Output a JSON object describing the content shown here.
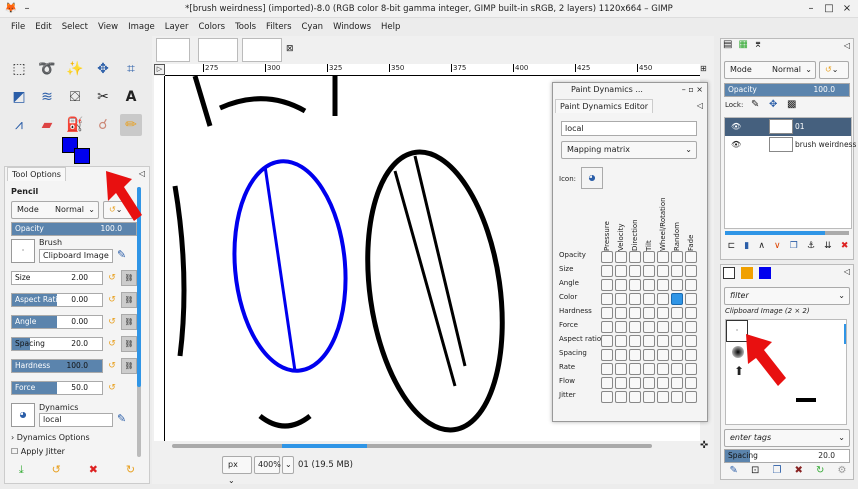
{
  "window": {
    "title": "*[brush weirdness] (imported)-8.0 (RGB color 8-bit gamma integer, GIMP built-in sRGB, 2 layers) 1120x664 – GIMP"
  },
  "menu": [
    "File",
    "Edit",
    "Select",
    "View",
    "Image",
    "Layer",
    "Colors",
    "Tools",
    "Filters",
    "Cyan",
    "Windows",
    "Help"
  ],
  "colors": {
    "foreground": "#0000ee",
    "background": "#0000ee",
    "accent": "#5b84ad",
    "arrow": "#e81010"
  },
  "tool_options": {
    "tab": "Tool Options",
    "tool": "Pencil",
    "mode_label": "Mode",
    "mode_value": "Normal",
    "opacity_label": "Opacity",
    "opacity_value": "100.0",
    "brush_label": "Brush",
    "brush_value": "Clipboard Image",
    "params": [
      {
        "label": "Size",
        "value": "2.00",
        "fill": 0
      },
      {
        "label": "Aspect Ratio",
        "value": "0.00",
        "fill": 0.5
      },
      {
        "label": "Angle",
        "value": "0.00",
        "fill": 0.5
      },
      {
        "label": "Spacing",
        "value": "20.0",
        "fill": 0.2
      },
      {
        "label": "Hardness",
        "value": "100.0",
        "fill": 1
      },
      {
        "label": "Force",
        "value": "50.0",
        "fill": 0.5
      }
    ],
    "dynamics_label": "Dynamics",
    "dynamics_value": "local",
    "dynamics_options": "Dynamics Options",
    "apply_jitter": "Apply Jitter"
  },
  "ruler": {
    "ticks": [
      "275",
      "300",
      "325",
      "350",
      "375",
      "400",
      "425",
      "450"
    ]
  },
  "status": {
    "unit": "px",
    "zoom": "400%",
    "info": "01 (19.5 MB)"
  },
  "paint_dynamics": {
    "window_title": "Paint Dynamics ...",
    "tab": "Paint Dynamics Editor",
    "name": "local",
    "view": "Mapping matrix",
    "icon_label": "Icon:",
    "columns": [
      "Pressure",
      "Velocity",
      "Direction",
      "Tilt",
      "Wheel/Rotation",
      "Random",
      "Fade"
    ],
    "rows": [
      "Opacity",
      "Size",
      "Angle",
      "Color",
      "Hardness",
      "Force",
      "Aspect ratio",
      "Spacing",
      "Rate",
      "Flow",
      "Jitter"
    ],
    "checked": [
      {
        "row": "Color",
        "column": "Random"
      }
    ]
  },
  "layers": {
    "mode_label": "Mode",
    "mode_value": "Normal",
    "opacity_label": "Opacity",
    "opacity_value": "100.0",
    "lock_label": "Lock:",
    "items": [
      {
        "name": "01",
        "selected": true
      },
      {
        "name": "brush weirdness",
        "selected": false
      }
    ]
  },
  "brushes": {
    "filter_placeholder": "filter",
    "current": "Clipboard Image (2 × 2)",
    "tags_placeholder": "enter tags",
    "spacing_label": "Spacing",
    "spacing_value": "20.0"
  }
}
